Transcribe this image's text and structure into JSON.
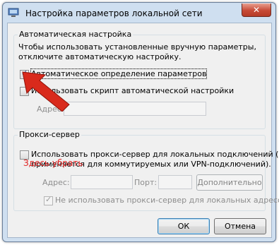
{
  "window": {
    "title": "Настройка параметров локальной сети",
    "close_label": "✕"
  },
  "auto": {
    "group_title": "Автоматическая настройка",
    "description_line1": "Чтобы использовать установленные вручную параметры,",
    "description_line2": "отключите автоматическую настройку.",
    "auto_detect_label": "Автоматическое определение параметров",
    "auto_detect_checked": true,
    "script_label": "Использовать скрипт автоматической настройки",
    "script_checked": false,
    "address_label": "Адрес",
    "address_value": ""
  },
  "proxy": {
    "group_title": "Прокси-сервер",
    "use_proxy_line1": "Использовать прокси-сервер для локальных подключений (не",
    "use_proxy_line2": "применяется для коммутируемых или VPN-подключений).",
    "use_proxy_checked": false,
    "address_label": "Адрес:",
    "address_value": "",
    "port_label": "Порт:",
    "port_value": "",
    "advanced_label": "Дополнительно",
    "bypass_label": "Не использовать прокси-сервер для локальных адресов",
    "bypass_checked": true
  },
  "annotation": {
    "text": "Здесь убрать",
    "color": "#e02020"
  },
  "buttons": {
    "ok_label": "ОК",
    "cancel_label": "Отмена"
  },
  "colors": {
    "frame": "#cfdff0",
    "client": "#f0f0f0",
    "close": "#c74a36"
  }
}
